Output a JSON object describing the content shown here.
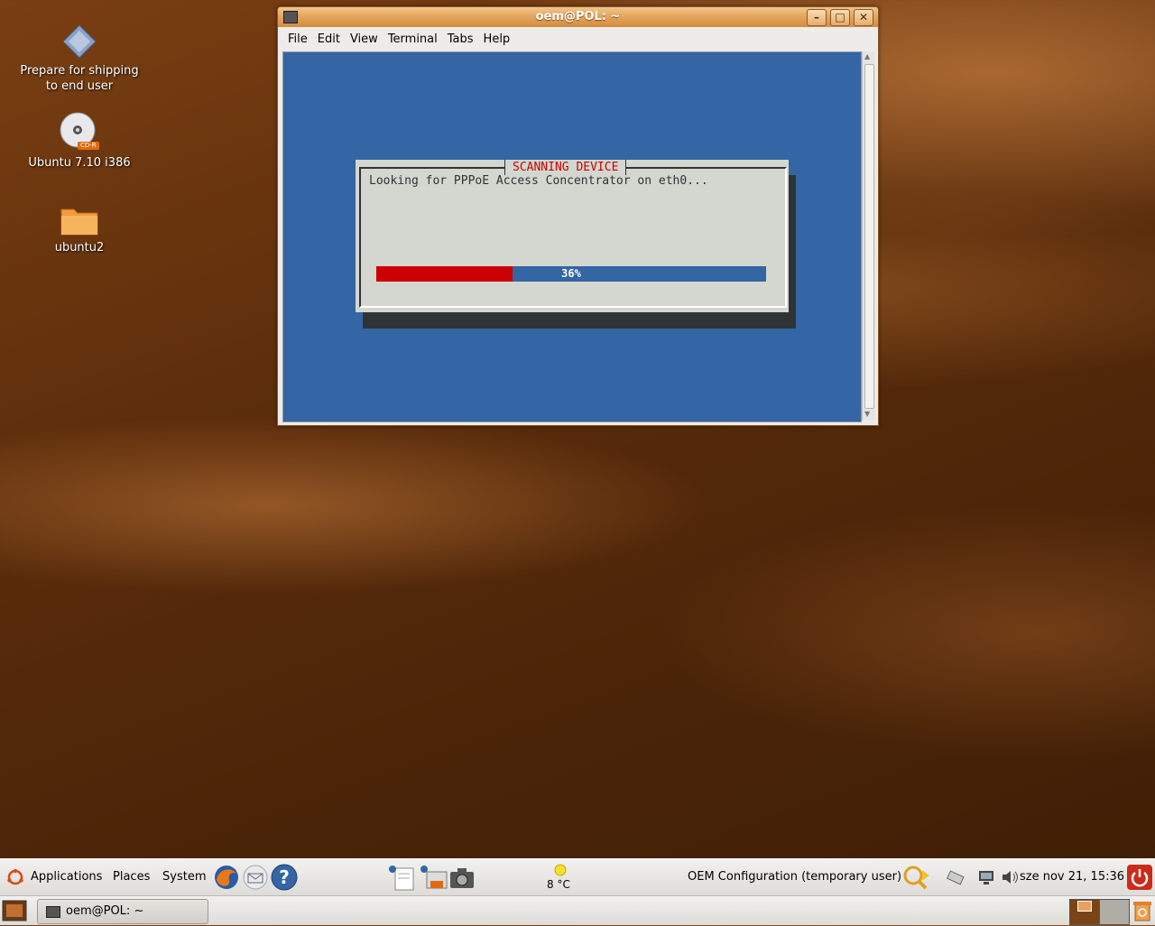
{
  "desktop": {
    "icons": [
      {
        "label_line1": "Prepare for shipping",
        "label_line2": "to end user"
      },
      {
        "label": "Ubuntu 7.10 i386",
        "badge": "CD-R"
      },
      {
        "label": "ubuntu2"
      }
    ]
  },
  "window": {
    "title": "oem@POL: ~",
    "menu": [
      "File",
      "Edit",
      "View",
      "Terminal",
      "Tabs",
      "Help"
    ]
  },
  "dialog": {
    "title": "SCANNING DEVICE",
    "message": "Looking for PPPoE Access Concentrator on eth0...",
    "progress_percent": 36,
    "progress_label": "36%"
  },
  "top_panel": {
    "applications": "Applications",
    "places": "Places",
    "system": "System",
    "weather": "8 °C",
    "user": "OEM Configuration (temporary user)",
    "clock": "sze nov 21, 15:36"
  },
  "bottom_panel": {
    "task_label": "oem@POL: ~"
  },
  "colors": {
    "terminal_bg": "#3465a4",
    "dialog_bg": "#d3d7cf",
    "dialog_title": "#cc0000",
    "progress_fill": "#cc0000",
    "titlebar": "#e2a35a"
  }
}
